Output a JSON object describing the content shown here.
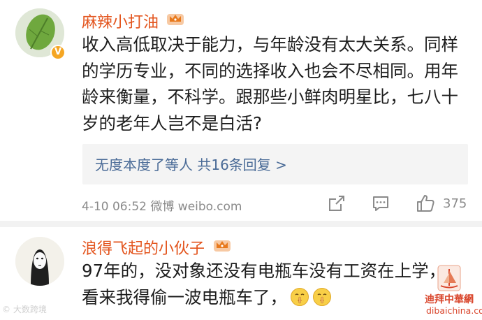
{
  "comments": [
    {
      "username": "麻辣小打油",
      "body_lines": [
        "收入高低取决于能力，与年龄没有太大关系。同样",
        "的学历专业，不同的选择收入也会不尽相同。用年",
        "龄来衡量，不科学。跟那些小鲜肉明星比，七八十",
        "岁的老年人岂不是白活?"
      ],
      "reply_summary": "无度本度了等人  共16条回复 >",
      "meta": "4-10 06:52  微博 weibo.com",
      "like_count": "375",
      "verified_badge": "V"
    },
    {
      "username": "浪得飞起的小伙子",
      "body_lines": [
        "97年的，没对象还没有电瓶车没有工资在上学，",
        "看来我得偷一波电瓶车了，"
      ]
    }
  ],
  "watermarks": {
    "left": "大数跨境",
    "right_cn": "迪拜中華網",
    "right_url": "dibaichina.com"
  },
  "icons": {
    "share": "share-icon",
    "comment": "comment-icon",
    "like": "thumbs-up-icon",
    "crown": "crown-badge-icon",
    "emoji": "shush-face-emoji"
  },
  "colors": {
    "username": "#e3551e",
    "reply_link": "#4a6b97",
    "meta_gray": "#8a8a8a",
    "divider": "#f2f2f2"
  }
}
